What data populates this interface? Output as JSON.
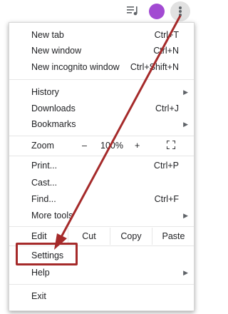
{
  "menu": {
    "items": [
      {
        "label": "New tab",
        "shortcut": "Ctrl+T"
      },
      {
        "label": "New window",
        "shortcut": "Ctrl+N"
      },
      {
        "label": "New incognito window",
        "shortcut": "Ctrl+Shift+N"
      },
      {
        "label": "History",
        "shortcut": ""
      },
      {
        "label": "Downloads",
        "shortcut": "Ctrl+J"
      },
      {
        "label": "Bookmarks",
        "shortcut": ""
      },
      {
        "label": "Print...",
        "shortcut": "Ctrl+P"
      },
      {
        "label": "Cast...",
        "shortcut": ""
      },
      {
        "label": "Find...",
        "shortcut": "Ctrl+F"
      },
      {
        "label": "More tools",
        "shortcut": ""
      },
      {
        "label": "Settings",
        "shortcut": ""
      },
      {
        "label": "Help",
        "shortcut": ""
      },
      {
        "label": "Exit",
        "shortcut": ""
      }
    ],
    "zoom": {
      "label": "Zoom",
      "minus": "–",
      "level": "100%",
      "plus": "+"
    },
    "edit": {
      "label": "Edit",
      "cut": "Cut",
      "copy": "Copy",
      "paste": "Paste"
    }
  },
  "colors": {
    "avatar": "#a24ad2",
    "annotation": "#a52a2a"
  },
  "icons": [
    "queue-icon",
    "avatar",
    "kebab-menu-icon",
    "fullscreen-icon",
    "chevron-right-icon"
  ]
}
